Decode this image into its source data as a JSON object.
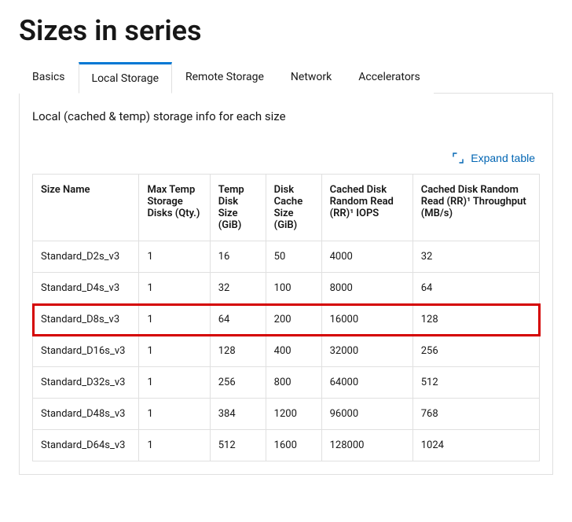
{
  "title": "Sizes in series",
  "tabs": {
    "items": [
      {
        "label": "Basics"
      },
      {
        "label": "Local Storage"
      },
      {
        "label": "Remote Storage"
      },
      {
        "label": "Network"
      },
      {
        "label": "Accelerators"
      }
    ],
    "active_index": 1
  },
  "panel": {
    "description": "Local (cached & temp) storage info for each size",
    "expand_label": "Expand table"
  },
  "table": {
    "headers": [
      "Size Name",
      "Max Temp Storage Disks (Qty.)",
      "Temp Disk Size (GiB)",
      "Disk Cache Size (GiB)",
      "Cached Disk Random Read (RR)¹ IOPS",
      "Cached Disk Random Read (RR)¹ Throughput (MB/s)"
    ],
    "rows": [
      {
        "cells": [
          "Standard_D2s_v3",
          "1",
          "16",
          "50",
          "4000",
          "32"
        ],
        "highlight": false
      },
      {
        "cells": [
          "Standard_D4s_v3",
          "1",
          "32",
          "100",
          "8000",
          "64"
        ],
        "highlight": false
      },
      {
        "cells": [
          "Standard_D8s_v3",
          "1",
          "64",
          "200",
          "16000",
          "128"
        ],
        "highlight": true
      },
      {
        "cells": [
          "Standard_D16s_v3",
          "1",
          "128",
          "400",
          "32000",
          "256"
        ],
        "highlight": false
      },
      {
        "cells": [
          "Standard_D32s_v3",
          "1",
          "256",
          "800",
          "64000",
          "512"
        ],
        "highlight": false
      },
      {
        "cells": [
          "Standard_D48s_v3",
          "1",
          "384",
          "1200",
          "96000",
          "768"
        ],
        "highlight": false
      },
      {
        "cells": [
          "Standard_D64s_v3",
          "1",
          "512",
          "1600",
          "128000",
          "1024"
        ],
        "highlight": false
      }
    ]
  }
}
